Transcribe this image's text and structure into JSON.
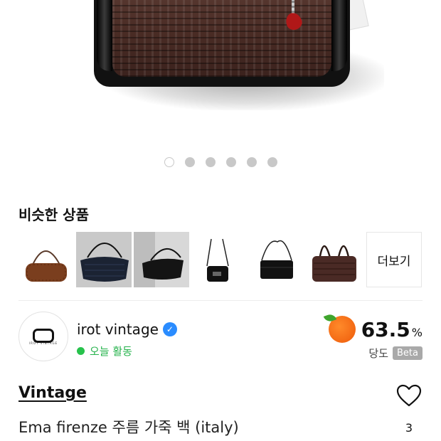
{
  "hero": {
    "image_icon": "handbag-photo",
    "pagination": {
      "total": 6,
      "active_index": 0
    }
  },
  "similar": {
    "title": "비슷한 상품",
    "items": [
      {
        "icon": "brown-shoulder-bag"
      },
      {
        "icon": "navy-croc-shoulder-bag"
      },
      {
        "icon": "black-shoulder-bag-photo"
      },
      {
        "icon": "black-crossbody-bag"
      },
      {
        "icon": "black-crossbody-clutch"
      },
      {
        "icon": "brown-tote-bag"
      }
    ],
    "more_label": "더보기"
  },
  "seller": {
    "name": "irot vintage",
    "verified_icon": "verified-check-icon",
    "status": "오늘 활동",
    "status_color": "#27b34d",
    "avatar_text": "IROT VINTAGE",
    "score": {
      "value": "63.5",
      "unit": "%",
      "label": "당도",
      "badge": "Beta",
      "icon": "orange-fruit-icon"
    }
  },
  "product": {
    "brand": "Vintage",
    "name": "Ema firenze 주름 가죽 백 (italy)",
    "like_count": "3"
  }
}
